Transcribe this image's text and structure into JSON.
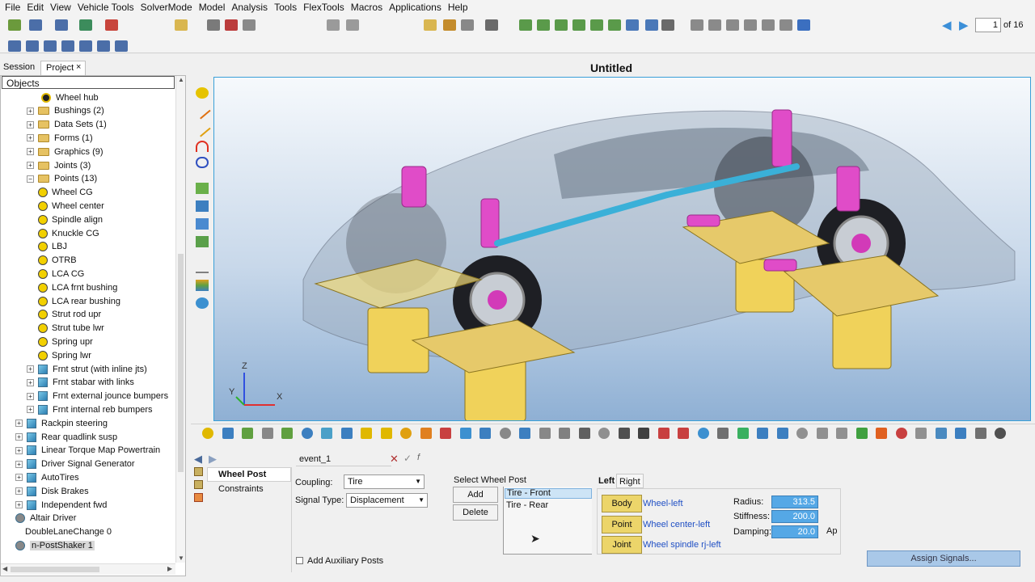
{
  "menu": [
    "File",
    "Edit",
    "View",
    "Vehicle Tools",
    "SolverMode",
    "Model",
    "Analysis",
    "Tools",
    "FlexTools",
    "Macros",
    "Applications",
    "Help"
  ],
  "page_nav": {
    "current": "1",
    "total": "of 16"
  },
  "tabs": {
    "session": "Session",
    "project": "Project",
    "close": "×"
  },
  "browser": {
    "header": "Objects",
    "items": [
      {
        "label": "Wheel hub",
        "icon": "wheel-hub-icon",
        "expander": ""
      },
      {
        "label": "Bushings (2)",
        "icon": "folder-icon",
        "expander": "+"
      },
      {
        "label": "Data Sets (1)",
        "icon": "folder-icon",
        "expander": "+"
      },
      {
        "label": "Forms (1)",
        "icon": "folder-icon",
        "expander": "+"
      },
      {
        "label": "Graphics (9)",
        "icon": "folder-icon",
        "expander": "+"
      },
      {
        "label": "Joints (3)",
        "icon": "folder-icon",
        "expander": "+"
      },
      {
        "label": "Points (13)",
        "icon": "folder-icon",
        "expander": "−"
      },
      {
        "label": "Wheel CG",
        "icon": "point-icon",
        "expander": ""
      },
      {
        "label": "Wheel center",
        "icon": "point-icon",
        "expander": ""
      },
      {
        "label": "Spindle align",
        "icon": "point-icon",
        "expander": ""
      },
      {
        "label": "Knuckle CG",
        "icon": "point-icon",
        "expander": ""
      },
      {
        "label": "LBJ",
        "icon": "point-icon",
        "expander": ""
      },
      {
        "label": "OTRB",
        "icon": "point-icon",
        "expander": ""
      },
      {
        "label": "LCA CG",
        "icon": "point-icon",
        "expander": ""
      },
      {
        "label": "LCA frnt bushing",
        "icon": "point-icon",
        "expander": ""
      },
      {
        "label": "LCA rear bushing",
        "icon": "point-icon",
        "expander": ""
      },
      {
        "label": "Strut rod upr",
        "icon": "point-icon",
        "expander": ""
      },
      {
        "label": "Strut tube lwr",
        "icon": "point-icon",
        "expander": ""
      },
      {
        "label": "Spring upr",
        "icon": "point-icon",
        "expander": ""
      },
      {
        "label": "Spring lwr",
        "icon": "point-icon",
        "expander": ""
      },
      {
        "label": "Frnt strut (with inline jts)",
        "icon": "system-icon",
        "expander": "+"
      },
      {
        "label": "Frnt stabar with links",
        "icon": "system-icon",
        "expander": "+"
      },
      {
        "label": "Frnt external jounce bumpers",
        "icon": "system-icon",
        "expander": "+"
      },
      {
        "label": "Frnt internal reb bumpers",
        "icon": "system-icon",
        "expander": "+"
      },
      {
        "label": "Rackpin steering",
        "icon": "system-icon",
        "expander": "+"
      },
      {
        "label": "Rear quadlink susp",
        "icon": "system-icon",
        "expander": "+"
      },
      {
        "label": "Linear Torque Map Powertrain",
        "icon": "system-icon",
        "expander": "+"
      },
      {
        "label": "Driver Signal Generator",
        "icon": "system-icon",
        "expander": "+"
      },
      {
        "label": "AutoTires",
        "icon": "system-icon",
        "expander": "+"
      },
      {
        "label": "Disk Brakes",
        "icon": "system-icon",
        "expander": "+"
      },
      {
        "label": "Independent fwd",
        "icon": "system-icon",
        "expander": "+"
      },
      {
        "label": "Altair Driver",
        "icon": "driver-icon",
        "expander": ""
      },
      {
        "label": "DoubleLaneChange 0",
        "icon": "none",
        "expander": ""
      },
      {
        "label": "n-PostShaker 1",
        "icon": "shaker-icon",
        "expander": ""
      }
    ]
  },
  "viewport": {
    "title": "Untitled",
    "triad": {
      "z": "Z",
      "y": "Y",
      "x": "X"
    }
  },
  "bottom": {
    "event_name": "event_1",
    "nav_tabs": {
      "wheel_post": "Wheel Post",
      "constraints": "Constraints"
    },
    "coupling": {
      "label": "Coupling:",
      "value": "Tire"
    },
    "signal_type": {
      "label": "Signal Type:",
      "value": "Displacement"
    },
    "add_aux": "Add Auxiliary Posts",
    "select_wheel_post": "Select Wheel Post",
    "add": "Add",
    "delete": "Delete",
    "posts": [
      "Tire - Front",
      "Tire - Rear"
    ],
    "side_tabs": {
      "left": "Left",
      "right": "Right"
    },
    "body": {
      "label": "Body",
      "value": "Wheel-left"
    },
    "point": {
      "label": "Point",
      "value": "Wheel center-left"
    },
    "joint": {
      "label": "Joint",
      "value": "Wheel spindle rj-left"
    },
    "radius": {
      "label": "Radius:",
      "value": "313.5"
    },
    "stiffness": {
      "label": "Stiffness:",
      "value": "200.0"
    },
    "damping": {
      "label": "Damping:",
      "value": "20.0"
    },
    "ap": "Ap",
    "assign": "Assign Signals..."
  }
}
